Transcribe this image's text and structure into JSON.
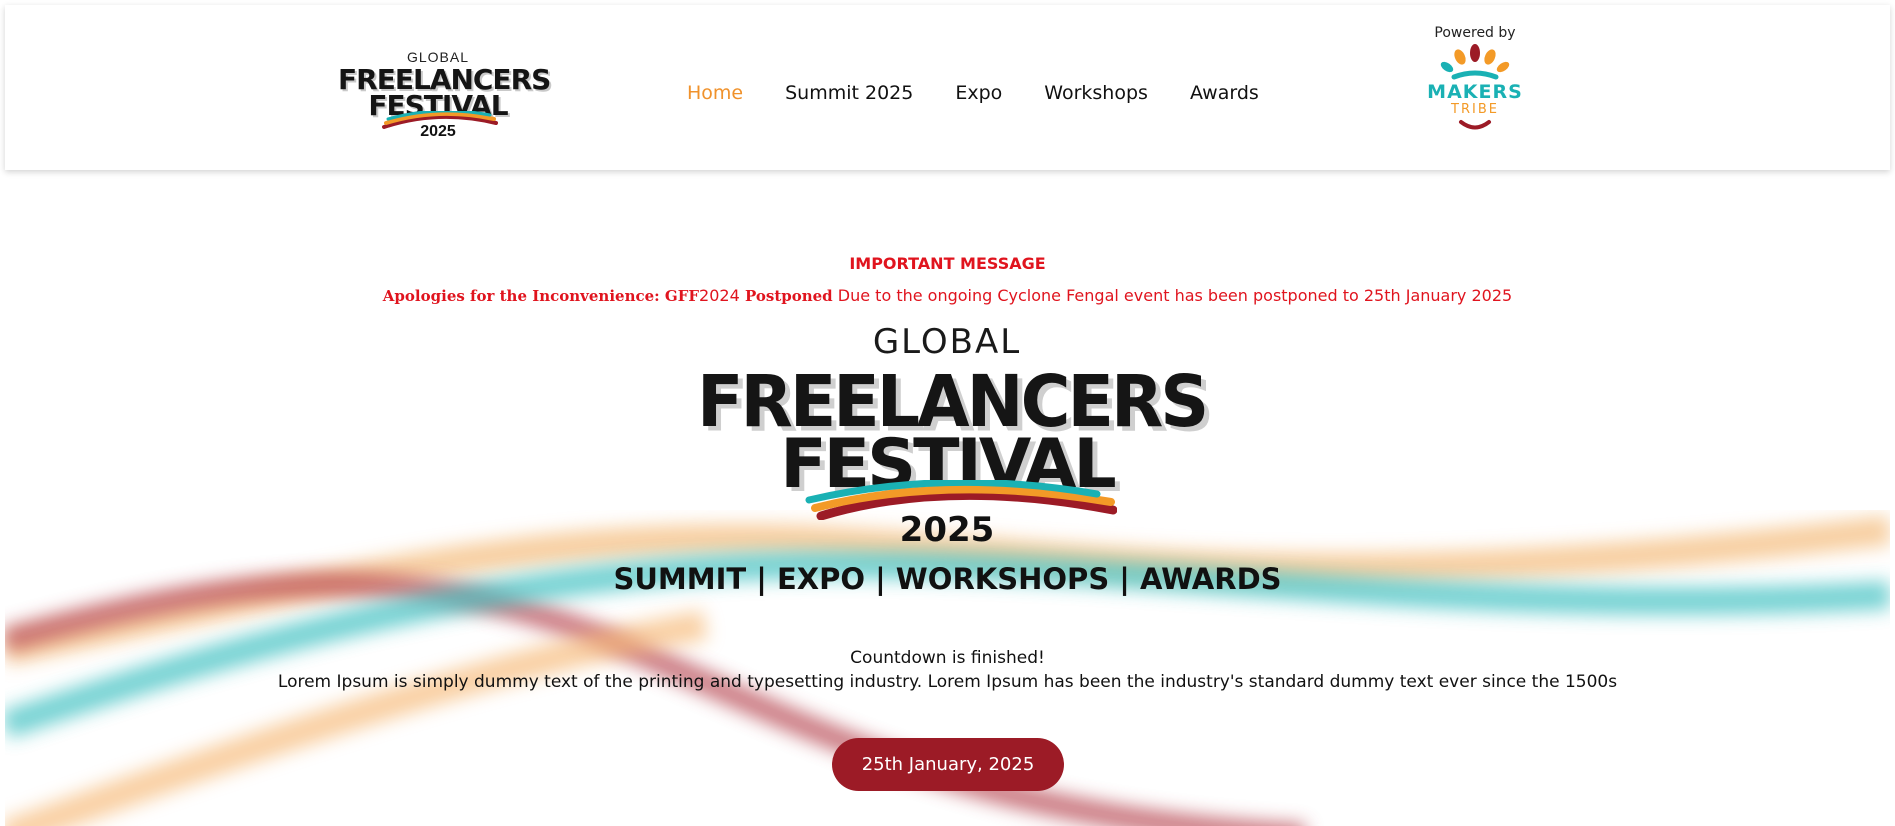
{
  "header": {
    "logo": {
      "global": "GLOBAL",
      "line1": "FREELANCERS",
      "line2": "FESTIVAL",
      "year": "2025"
    },
    "nav": [
      {
        "label": "Home",
        "active": true
      },
      {
        "label": "Summit 2025",
        "active": false
      },
      {
        "label": "Expo",
        "active": false
      },
      {
        "label": "Workshops",
        "active": false
      },
      {
        "label": "Awards",
        "active": false
      }
    ],
    "powered_by": {
      "label": "Powered by",
      "brand_line1": "MAKERS",
      "brand_line2": "TRIBE"
    }
  },
  "notice": {
    "title": "IMPORTANT MESSAGE",
    "bold_lead": "Apologies for the Inconvenience: GFF",
    "year_text": "2024",
    "bold_postponed": " Postponed",
    "body": " Due to the ongoing Cyclone Fengal event has been postponed to 25th January 2025"
  },
  "hero": {
    "global": "GLOBAL",
    "line1": "FREELANCERS",
    "line2": "FESTIVAL",
    "year": "2025",
    "tagline": "SUMMIT | EXPO | WORKSHOPS | AWARDS",
    "countdown": "Countdown is finished!",
    "description": "Lorem Ipsum is simply dummy text of the printing and typesetting industry. Lorem Ipsum has been the industry's standard dummy text ever since the 1500s",
    "date_button": "25th January, 2025"
  },
  "colors": {
    "accent_orange": "#f0922c",
    "alert_red": "#e0141e",
    "button_maroon": "#9c1b26",
    "teal": "#1ab1b4",
    "maroon_wave": "#b5424d",
    "orange_wave": "#f6b874"
  }
}
